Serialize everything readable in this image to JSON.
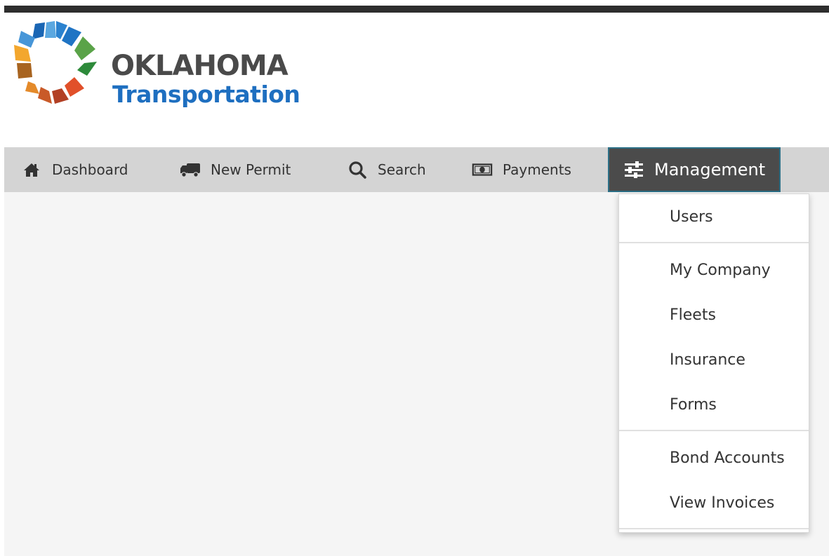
{
  "brand": {
    "title": "OKLAHOMA",
    "subtitle": "Transportation"
  },
  "nav": {
    "items": [
      {
        "label": "Dashboard",
        "icon": "home-icon"
      },
      {
        "label": "New Permit",
        "icon": "truck-icon"
      },
      {
        "label": "Search",
        "icon": "search-icon"
      },
      {
        "label": "Payments",
        "icon": "money-bill-icon"
      },
      {
        "label": "Management",
        "icon": "sliders-icon",
        "active": true
      }
    ]
  },
  "management_menu": {
    "items": [
      {
        "label": "Users"
      },
      {
        "label": "My Company"
      },
      {
        "label": "Fleets"
      },
      {
        "label": "Insurance"
      },
      {
        "label": "Forms"
      },
      {
        "label": "Bond Accounts"
      },
      {
        "label": "View Invoices"
      }
    ]
  },
  "colors": {
    "top_bar": "#2e2e2e",
    "nav_background": "#d4d4d4",
    "nav_active": "#4b4b4b",
    "brand_blue": "#1e6fc0",
    "brand_gray": "#4a4a4a",
    "content_background": "#f5f5f5"
  }
}
